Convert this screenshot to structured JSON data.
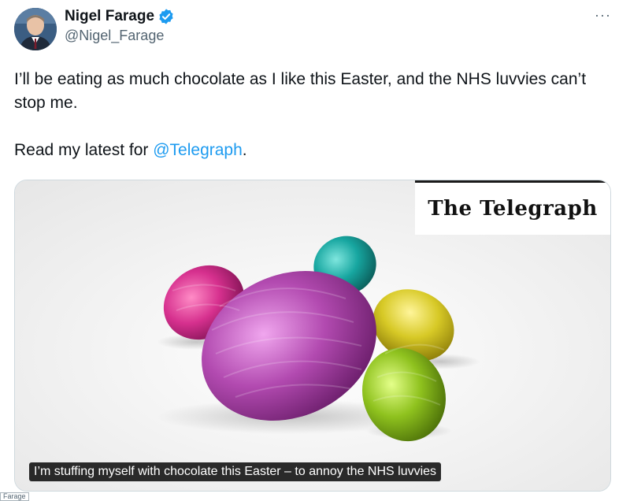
{
  "author": {
    "display_name": "Nigel Farage",
    "handle": "@Nigel_Farage",
    "verified": true
  },
  "menu": {
    "more_label": "···"
  },
  "tweet": {
    "line1": "I’ll be eating as much chocolate as I like this Easter, and the NHS luvvies can’t stop me.",
    "line2_prefix": "Read my latest for ",
    "mention": "@Telegraph",
    "line2_suffix": "."
  },
  "card": {
    "publisher": "The Telegraph",
    "caption": "I’m stuffing myself with chocolate this Easter – to annoy the NHS luvvies"
  },
  "footer": {
    "stub_text": "Farage"
  },
  "colors": {
    "link": "#1d9bf0",
    "verified_badge": "#1d9bf0",
    "egg_purple": "#b24ab0",
    "egg_pink": "#d6308e",
    "egg_teal": "#17a6a0",
    "egg_yellow": "#d7c926",
    "egg_green": "#8fc21e"
  }
}
